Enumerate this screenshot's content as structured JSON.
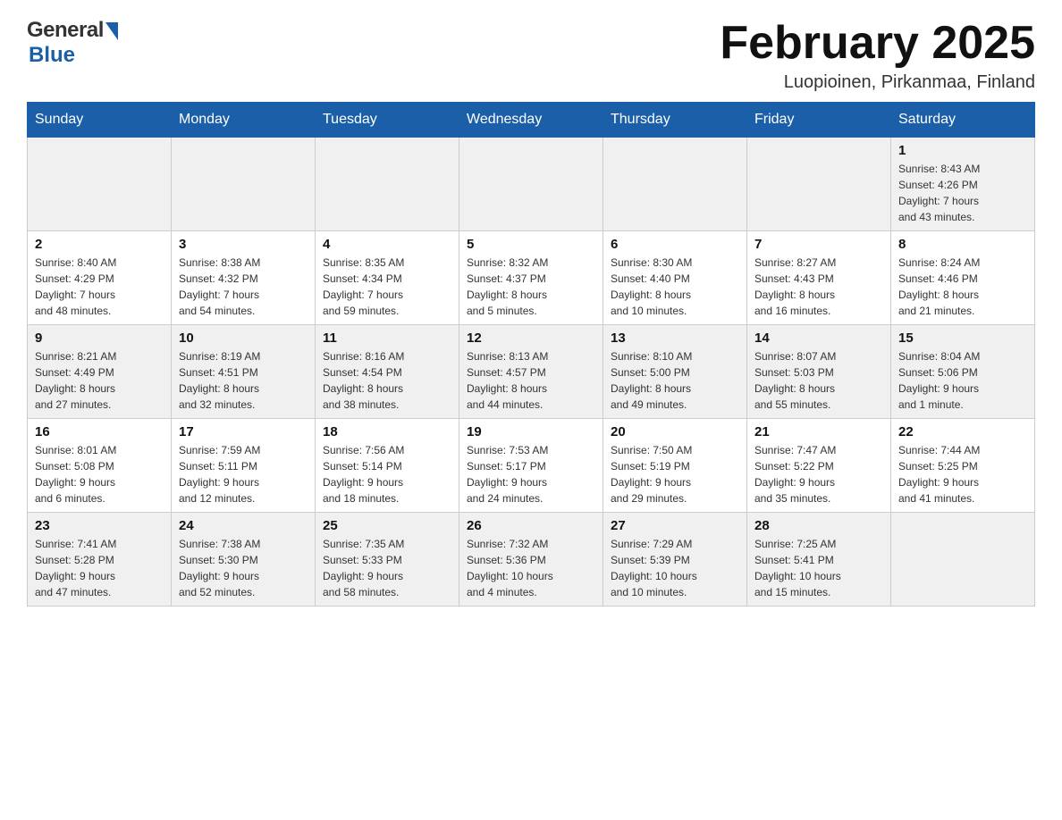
{
  "logo": {
    "text_general": "General",
    "text_blue": "Blue"
  },
  "header": {
    "title": "February 2025",
    "subtitle": "Luopioinen, Pirkanmaa, Finland"
  },
  "days_of_week": [
    "Sunday",
    "Monday",
    "Tuesday",
    "Wednesday",
    "Thursday",
    "Friday",
    "Saturday"
  ],
  "weeks": [
    {
      "days": [
        {
          "number": "",
          "info": ""
        },
        {
          "number": "",
          "info": ""
        },
        {
          "number": "",
          "info": ""
        },
        {
          "number": "",
          "info": ""
        },
        {
          "number": "",
          "info": ""
        },
        {
          "number": "",
          "info": ""
        },
        {
          "number": "1",
          "info": "Sunrise: 8:43 AM\nSunset: 4:26 PM\nDaylight: 7 hours\nand 43 minutes."
        }
      ]
    },
    {
      "days": [
        {
          "number": "2",
          "info": "Sunrise: 8:40 AM\nSunset: 4:29 PM\nDaylight: 7 hours\nand 48 minutes."
        },
        {
          "number": "3",
          "info": "Sunrise: 8:38 AM\nSunset: 4:32 PM\nDaylight: 7 hours\nand 54 minutes."
        },
        {
          "number": "4",
          "info": "Sunrise: 8:35 AM\nSunset: 4:34 PM\nDaylight: 7 hours\nand 59 minutes."
        },
        {
          "number": "5",
          "info": "Sunrise: 8:32 AM\nSunset: 4:37 PM\nDaylight: 8 hours\nand 5 minutes."
        },
        {
          "number": "6",
          "info": "Sunrise: 8:30 AM\nSunset: 4:40 PM\nDaylight: 8 hours\nand 10 minutes."
        },
        {
          "number": "7",
          "info": "Sunrise: 8:27 AM\nSunset: 4:43 PM\nDaylight: 8 hours\nand 16 minutes."
        },
        {
          "number": "8",
          "info": "Sunrise: 8:24 AM\nSunset: 4:46 PM\nDaylight: 8 hours\nand 21 minutes."
        }
      ]
    },
    {
      "days": [
        {
          "number": "9",
          "info": "Sunrise: 8:21 AM\nSunset: 4:49 PM\nDaylight: 8 hours\nand 27 minutes."
        },
        {
          "number": "10",
          "info": "Sunrise: 8:19 AM\nSunset: 4:51 PM\nDaylight: 8 hours\nand 32 minutes."
        },
        {
          "number": "11",
          "info": "Sunrise: 8:16 AM\nSunset: 4:54 PM\nDaylight: 8 hours\nand 38 minutes."
        },
        {
          "number": "12",
          "info": "Sunrise: 8:13 AM\nSunset: 4:57 PM\nDaylight: 8 hours\nand 44 minutes."
        },
        {
          "number": "13",
          "info": "Sunrise: 8:10 AM\nSunset: 5:00 PM\nDaylight: 8 hours\nand 49 minutes."
        },
        {
          "number": "14",
          "info": "Sunrise: 8:07 AM\nSunset: 5:03 PM\nDaylight: 8 hours\nand 55 minutes."
        },
        {
          "number": "15",
          "info": "Sunrise: 8:04 AM\nSunset: 5:06 PM\nDaylight: 9 hours\nand 1 minute."
        }
      ]
    },
    {
      "days": [
        {
          "number": "16",
          "info": "Sunrise: 8:01 AM\nSunset: 5:08 PM\nDaylight: 9 hours\nand 6 minutes."
        },
        {
          "number": "17",
          "info": "Sunrise: 7:59 AM\nSunset: 5:11 PM\nDaylight: 9 hours\nand 12 minutes."
        },
        {
          "number": "18",
          "info": "Sunrise: 7:56 AM\nSunset: 5:14 PM\nDaylight: 9 hours\nand 18 minutes."
        },
        {
          "number": "19",
          "info": "Sunrise: 7:53 AM\nSunset: 5:17 PM\nDaylight: 9 hours\nand 24 minutes."
        },
        {
          "number": "20",
          "info": "Sunrise: 7:50 AM\nSunset: 5:19 PM\nDaylight: 9 hours\nand 29 minutes."
        },
        {
          "number": "21",
          "info": "Sunrise: 7:47 AM\nSunset: 5:22 PM\nDaylight: 9 hours\nand 35 minutes."
        },
        {
          "number": "22",
          "info": "Sunrise: 7:44 AM\nSunset: 5:25 PM\nDaylight: 9 hours\nand 41 minutes."
        }
      ]
    },
    {
      "days": [
        {
          "number": "23",
          "info": "Sunrise: 7:41 AM\nSunset: 5:28 PM\nDaylight: 9 hours\nand 47 minutes."
        },
        {
          "number": "24",
          "info": "Sunrise: 7:38 AM\nSunset: 5:30 PM\nDaylight: 9 hours\nand 52 minutes."
        },
        {
          "number": "25",
          "info": "Sunrise: 7:35 AM\nSunset: 5:33 PM\nDaylight: 9 hours\nand 58 minutes."
        },
        {
          "number": "26",
          "info": "Sunrise: 7:32 AM\nSunset: 5:36 PM\nDaylight: 10 hours\nand 4 minutes."
        },
        {
          "number": "27",
          "info": "Sunrise: 7:29 AM\nSunset: 5:39 PM\nDaylight: 10 hours\nand 10 minutes."
        },
        {
          "number": "28",
          "info": "Sunrise: 7:25 AM\nSunset: 5:41 PM\nDaylight: 10 hours\nand 15 minutes."
        },
        {
          "number": "",
          "info": ""
        }
      ]
    }
  ]
}
